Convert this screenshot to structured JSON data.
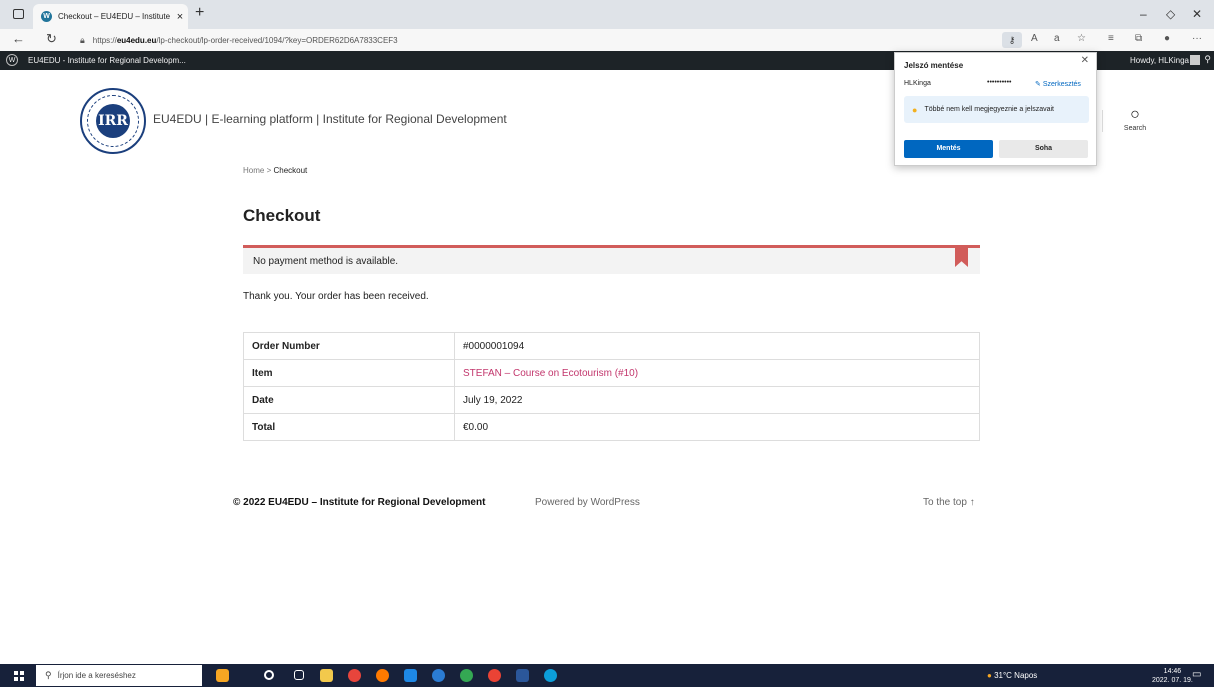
{
  "browser": {
    "tab_title": "Checkout – EU4EDU – Institute f…",
    "url_prefix": "https://",
    "url_domain": "eu4edu.eu",
    "url_path": "/lp-checkout/lp-order-received/1094/?key=ORDER62D6A7833CEF3"
  },
  "wp_admin_bar": {
    "site_name": "EU4EDU - Institute for Regional Developm...",
    "howdy": "Howdy, HLKinga"
  },
  "header": {
    "site_title": "EU4EDU | E-learning platform | Institute for Regional Development",
    "search_label": "Search",
    "logo_text": "IRR"
  },
  "breadcrumb": {
    "home": "Home",
    "sep": ">",
    "current": "Checkout"
  },
  "page_title": "Checkout",
  "notice": "No payment method is available.",
  "thanks": "Thank you. Your order has been received.",
  "order": {
    "rows": [
      {
        "label": "Order Number",
        "value": "#0000001094"
      },
      {
        "label": "Item",
        "value": "STEFAN – Course on Ecotourism (#10)"
      },
      {
        "label": "Date",
        "value": "July 19, 2022"
      },
      {
        "label": "Total",
        "value": "€0.00"
      }
    ]
  },
  "footer": {
    "copyright": "© 2022 EU4EDU – Institute for Regional Development",
    "powered": "Powered by WordPress",
    "to_top": "To the top ↑"
  },
  "password_popup": {
    "title": "Jelszó mentése",
    "username": "HLKinga",
    "password_mask": "••••••••••",
    "edit": "Szerkesztés",
    "tip": "Többé nem kell megjegyeznie a jelszavait",
    "save": "Mentés",
    "never": "Soha"
  },
  "taskbar": {
    "search_placeholder": "Írjon ide a kereséshez",
    "weather": "31°C Napos",
    "time": "14:46",
    "date": "2022. 07. 19."
  },
  "colors": {
    "accent": "#c2366c",
    "notice": "#d15c5a",
    "edge_blue": "#0067c0",
    "logo": "#1b3f7d"
  }
}
